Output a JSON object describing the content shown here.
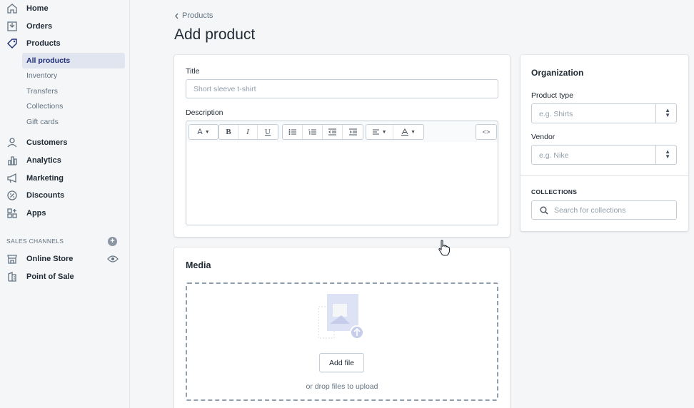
{
  "sidebar": {
    "items": [
      {
        "label": "Home",
        "icon": "home-icon"
      },
      {
        "label": "Orders",
        "icon": "orders-icon"
      },
      {
        "label": "Products",
        "icon": "tag-icon"
      }
    ],
    "product_sub": [
      {
        "label": "All products",
        "active": true
      },
      {
        "label": "Inventory"
      },
      {
        "label": "Transfers"
      },
      {
        "label": "Collections"
      },
      {
        "label": "Gift cards"
      }
    ],
    "items2": [
      {
        "label": "Customers",
        "icon": "person-icon"
      },
      {
        "label": "Analytics",
        "icon": "bar-chart-icon"
      },
      {
        "label": "Marketing",
        "icon": "megaphone-icon"
      },
      {
        "label": "Discounts",
        "icon": "discount-icon"
      },
      {
        "label": "Apps",
        "icon": "apps-icon"
      }
    ],
    "sales_channels_label": "SALES CHANNELS",
    "channels": [
      {
        "label": "Online Store",
        "icon": "store-icon"
      },
      {
        "label": "Point of Sale",
        "icon": "pos-icon"
      }
    ]
  },
  "header": {
    "back_label": "Products",
    "title": "Add product"
  },
  "form": {
    "title_label": "Title",
    "title_placeholder": "Short sleeve t-shirt",
    "description_label": "Description",
    "toolbar": {
      "font_label": "A",
      "bold": "B",
      "italic": "I",
      "underline": "U",
      "code": "<>"
    }
  },
  "media": {
    "title": "Media",
    "add_file_label": "Add file",
    "drop_hint": "or drop files to upload"
  },
  "organization": {
    "title": "Organization",
    "product_type_label": "Product type",
    "product_type_placeholder": "e.g. Shirts",
    "vendor_label": "Vendor",
    "vendor_placeholder": "e.g. Nike",
    "collections_label": "COLLECTIONS",
    "collections_placeholder": "Search for collections"
  },
  "colors": {
    "active_nav_bg": "#e1e5f0",
    "active_nav_text": "#202e78"
  }
}
